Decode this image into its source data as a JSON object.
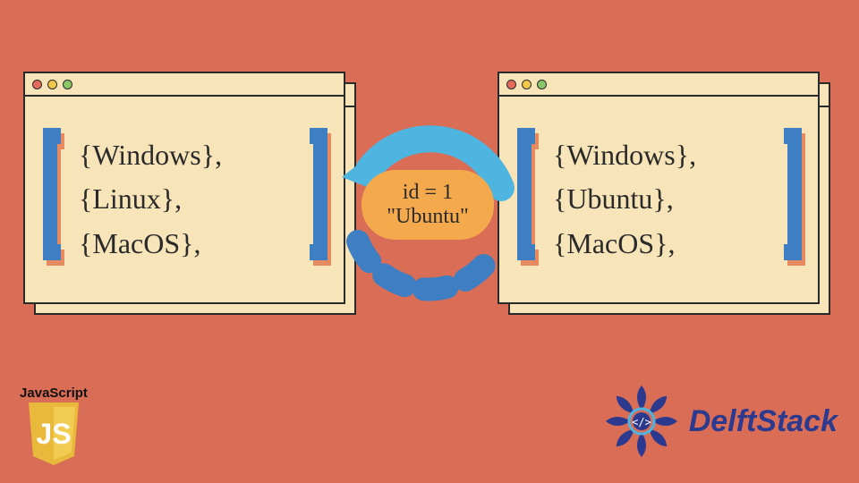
{
  "left_window": {
    "items": [
      "{Windows},",
      "{Linux},",
      "{MacOS},"
    ]
  },
  "right_window": {
    "items": [
      "{Windows},",
      "{Ubuntu},",
      "{MacOS},"
    ]
  },
  "badge": {
    "line1": "id = 1",
    "line2": "\"Ubuntu\""
  },
  "js_logo": {
    "label": "JavaScript",
    "initials": "JS"
  },
  "brand": {
    "name": "DelftStack"
  },
  "colors": {
    "bg": "#d96d56",
    "window": "#f7e4b8",
    "badge": "#f4a94d",
    "arrow_solid": "#4db5e0",
    "arrow_dash": "#3d7fc2",
    "bracket_front": "#3d7fc2",
    "bracket_shadow": "#e88a5f",
    "brand_blue": "#2b3a8f"
  }
}
